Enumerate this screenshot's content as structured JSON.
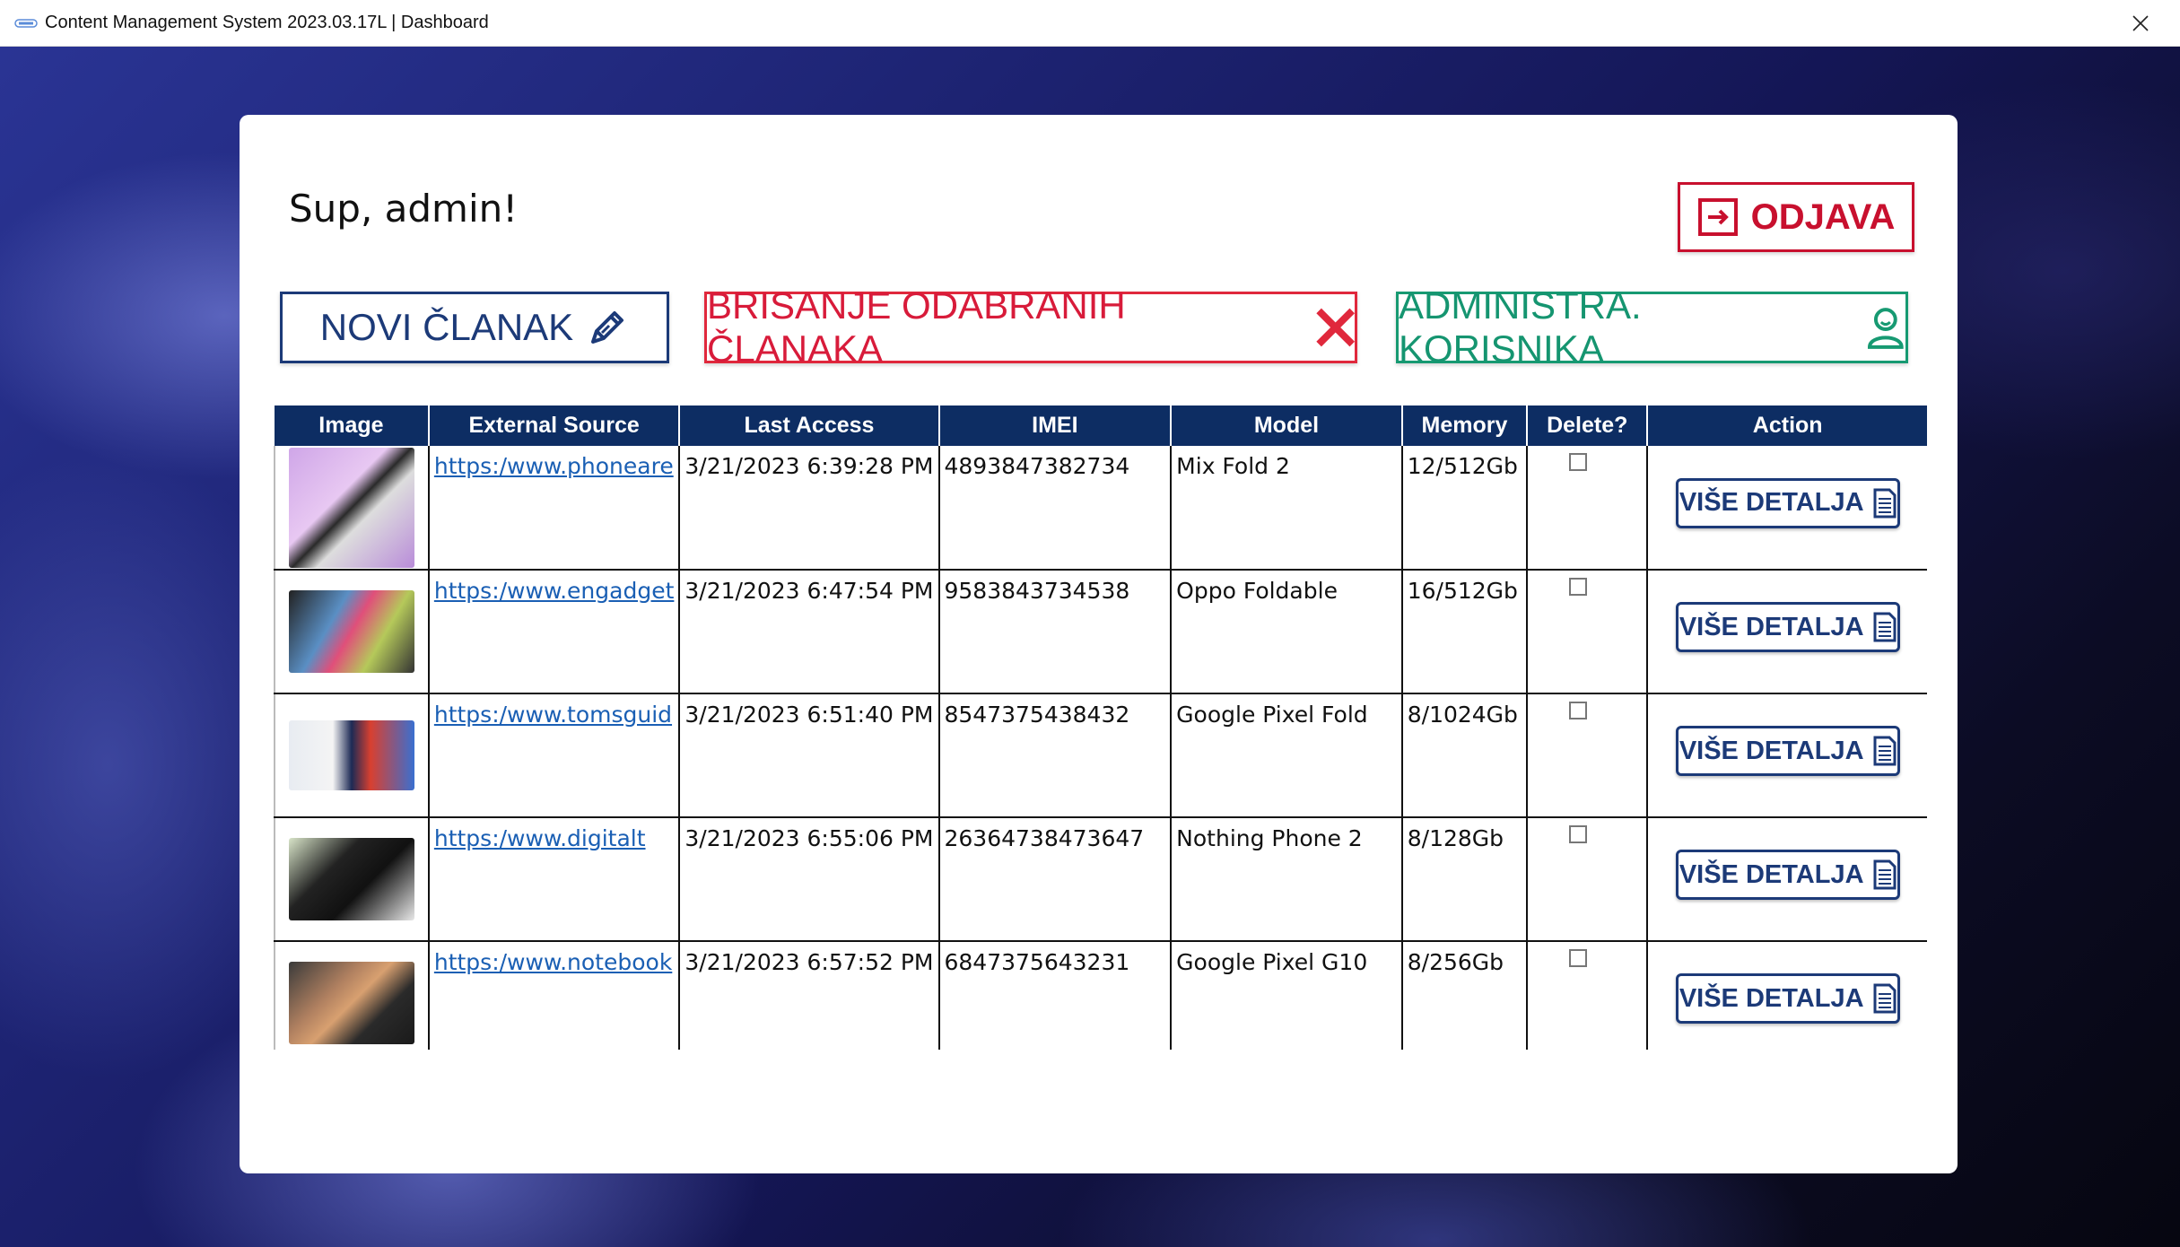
{
  "window": {
    "title": "Content Management System 2023.03.17L | Dashboard"
  },
  "header": {
    "greeting": "Sup, admin!",
    "logout_label": "ODJAVA"
  },
  "toolbar": {
    "new_article": "NOVI ČLANAK",
    "delete_selected": "BRISANJE ODABRANIH ČLANAKA",
    "user_admin": "ADMINISTRA. KORISNIKA"
  },
  "table": {
    "columns": [
      "Image",
      "External Source",
      "Last Access",
      "IMEI",
      "Model",
      "Memory",
      "Delete?",
      "Action"
    ],
    "action_label": "VIŠE DETALJA",
    "rows": [
      {
        "source": "https:/www.phoneare",
        "last_access": "3/21/2023 6:39:28 PM",
        "imei": "4893847382734",
        "model": "Mix Fold 2",
        "memory": "12/512Gb"
      },
      {
        "source": "https:/www.engadget",
        "last_access": "3/21/2023 6:47:54 PM",
        "imei": "9583843734538",
        "model": "Oppo Foldable",
        "memory": "16/512Gb"
      },
      {
        "source": "https:/www.tomsguid",
        "last_access": "3/21/2023 6:51:40 PM",
        "imei": "8547375438432",
        "model": "Google Pixel Fold",
        "memory": "8/1024Gb"
      },
      {
        "source": "https:/www.digitalt",
        "last_access": "3/21/2023 6:55:06 PM",
        "imei": "26364738473647",
        "model": "Nothing Phone 2",
        "memory": "8/128Gb"
      },
      {
        "source": "https:/www.notebook",
        "last_access": "3/21/2023 6:57:52 PM",
        "imei": "6847375643231",
        "model": "Google Pixel G10",
        "memory": "8/256Gb"
      }
    ]
  },
  "colors": {
    "header_navy": "#0d2d63",
    "logout_red": "#c8102e",
    "delete_red": "#e0283c",
    "admin_green": "#179a72",
    "primary_navy": "#1c3a78",
    "link_blue": "#1a5fb4"
  },
  "icons": {
    "app": "app-icon",
    "close": "close-icon",
    "logout": "logout-icon",
    "new_article": "pencil-icon",
    "delete": "x-icon",
    "user_admin": "user-icon",
    "details": "document-icon"
  }
}
